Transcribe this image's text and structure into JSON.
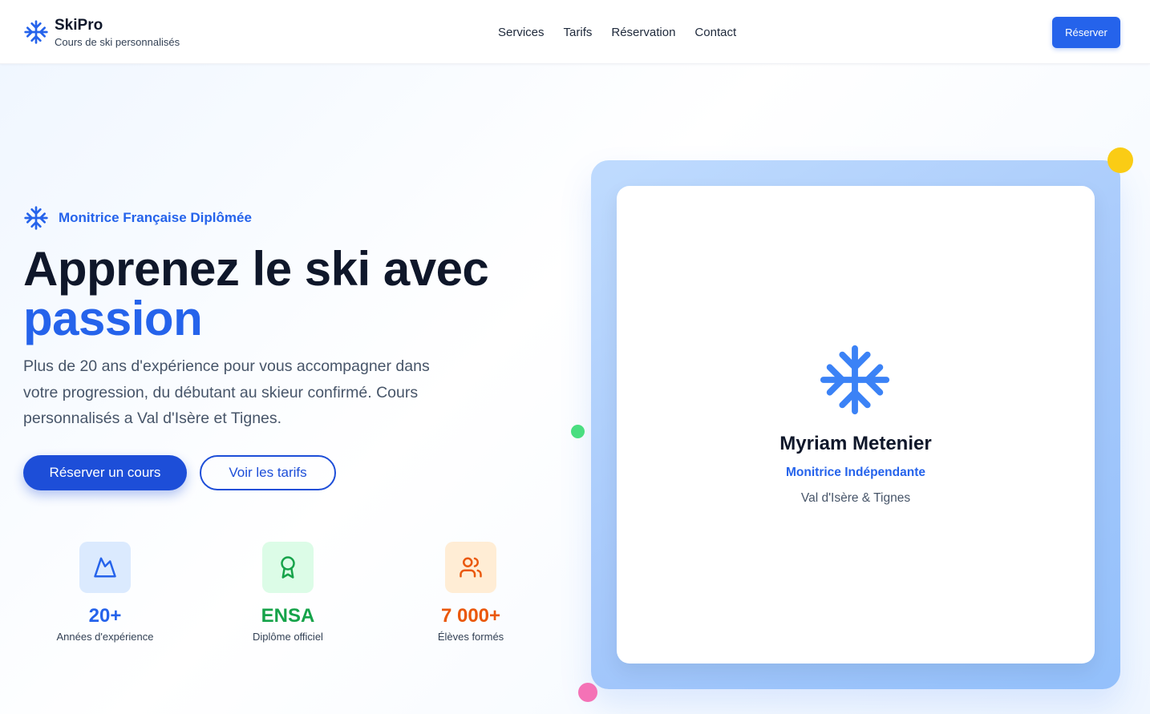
{
  "header": {
    "brand_name": "SkiPro",
    "brand_tagline": "Cours de ski personnalisés",
    "brand_icon": "snowflake-icon",
    "nav": [
      "Services",
      "Tarifs",
      "Réservation",
      "Contact"
    ],
    "cta_label": "Réserver"
  },
  "hero": {
    "badge_text": "Monitrice Française Diplômée",
    "badge_icon": "snowflake-icon",
    "title_line1": "Apprenez le ski avec",
    "title_accent": "passion",
    "lead": "Plus de 20 ans d'expérience pour vous accompagner dans votre progression, du débutant au skieur confirmé. Cours personnalisés a Val d'Isère et Tignes.",
    "primary_button": "Réserver un cours",
    "secondary_button": "Voir les tarifs"
  },
  "stats": [
    {
      "icon": "mountain-icon",
      "value": "20+",
      "label": "Années d'expérience",
      "color": "#2563eb",
      "bg": "#dbeafe"
    },
    {
      "icon": "award-icon",
      "value": "ENSA",
      "label": "Diplôme officiel",
      "color": "#16a34a",
      "bg": "#dcfce7"
    },
    {
      "icon": "users-icon",
      "value": "7 000+",
      "label": "Élèves formés",
      "color": "#ea580c",
      "bg": "#ffedd5"
    }
  ],
  "profile_card": {
    "icon": "snowflake-icon",
    "name": "Myriam Metenier",
    "role": "Monitrice Indépendante",
    "location": "Val d'Isère & Tignes"
  },
  "colors": {
    "primary": "#2563eb",
    "primary_dark": "#1d4ed8",
    "text_dark": "#0f172a",
    "text_muted": "#475569",
    "dot_yellow": "#facc15",
    "dot_green": "#4ade80",
    "dot_pink": "#f472b6"
  }
}
